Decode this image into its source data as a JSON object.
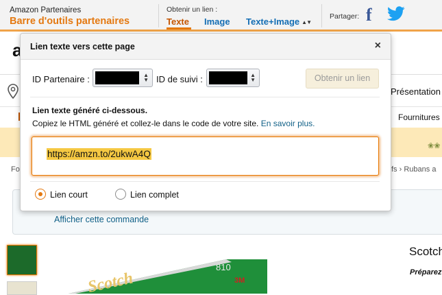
{
  "sitestripe": {
    "brand_small": "Amazon Partenaires",
    "brand_big": "Barre d'outils partenaires",
    "get_link_label": "Obtenir un lien :",
    "tabs": [
      "Texte",
      "Image",
      "Texte+Image"
    ],
    "active_tab": "Texte",
    "share_label": "Partager:",
    "share_icons": [
      "facebook-icon",
      "twitter-icon"
    ],
    "accent_color": "#e47911"
  },
  "popover": {
    "title": "Lien texte vers cette page",
    "close_glyph": "×",
    "partner_id_label": "ID Partenaire :",
    "tracking_id_label": "ID de suivi :",
    "get_link_button": "Obtenir un lien",
    "generated_title": "Lien texte généré ci-dessous.",
    "generated_desc": "Copiez le HTML généré et collez-le dans le code de votre site.",
    "learn_more": "En savoir plus.",
    "link_value": "https://amzn.to/2ukwA4Q",
    "radio_short": "Lien court",
    "radio_full": "Lien complet",
    "selected_radio": "Lien court"
  },
  "background_page": {
    "logo_fragment": "a",
    "nav_item_1": "Présentation",
    "nav_item_2": "Fournitures",
    "breadcrumb_left": "Fo",
    "breadcrumb_right_1": "fs",
    "breadcrumb_right_2": "Rubans a",
    "show_order_link": "Afficher cette commande",
    "product_title_fragment": "Scotch",
    "product_sub_fragment": "Préparez",
    "product_brand_text": "Scotch",
    "product_number_text": "810",
    "product_badge_text": "3M"
  }
}
